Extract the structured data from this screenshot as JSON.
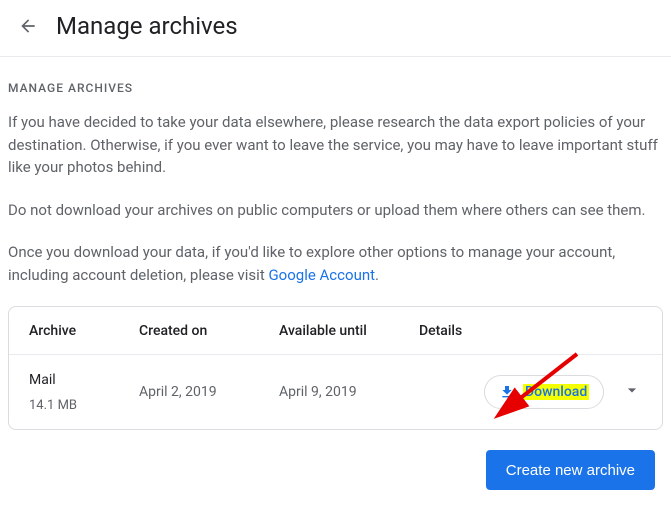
{
  "header": {
    "title": "Manage archives"
  },
  "section_label": "MANAGE ARCHIVES",
  "paragraphs": {
    "p1": "If you have decided to take your data elsewhere, please research the data export policies of your destination. Otherwise, if you ever want to leave the service, you may have to leave important stuff like your photos behind.",
    "p2": "Do not download your archives on public computers or upload them where others can see them.",
    "p3_prefix": "Once you download your data, if you'd like to explore other options to manage your account, including account deletion, please visit ",
    "p3_link": "Google Account",
    "p3_suffix": "."
  },
  "table": {
    "headers": {
      "archive": "Archive",
      "created": "Created on",
      "available": "Available until",
      "details": "Details"
    },
    "row": {
      "name": "Mail",
      "size": "14.1 MB",
      "created": "April 2, 2019",
      "available": "April 9, 2019",
      "download_label": "Download"
    }
  },
  "footer": {
    "create_label": "Create new archive"
  }
}
